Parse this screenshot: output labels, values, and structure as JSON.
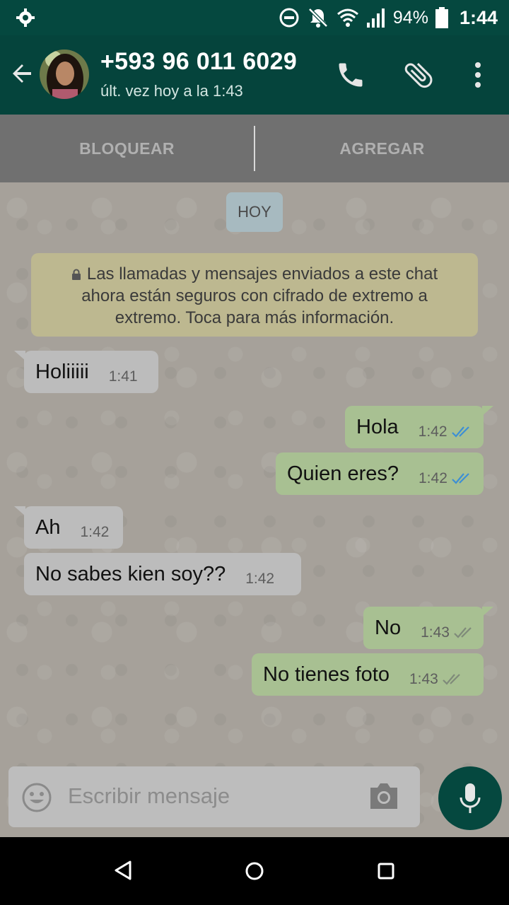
{
  "status_bar": {
    "battery_percent": "94%",
    "time": "1:44",
    "icons": [
      "settings-icon",
      "do-not-disturb-icon",
      "notifications-off-icon",
      "wifi-icon",
      "signal-icon",
      "battery-icon"
    ]
  },
  "header": {
    "contact_name": "+593 96 011 6029",
    "last_seen": "últ. vez hoy a la 1:43",
    "icons": [
      "back-arrow-icon",
      "avatar",
      "call-icon",
      "attach-icon",
      "more-vert-icon"
    ]
  },
  "actions": {
    "block_label": "BLOQUEAR",
    "add_label": "AGREGAR"
  },
  "chat": {
    "date_chip": "HOY",
    "encryption_notice": "Las llamadas y mensajes enviados a este chat ahora están seguros con cifrado de extremo a extremo. Toca para más información.",
    "messages": [
      {
        "direction": "in",
        "text": "Holiiiii",
        "time": "1:41"
      },
      {
        "direction": "out",
        "text": "Hola",
        "time": "1:42",
        "status": "read"
      },
      {
        "direction": "out",
        "text": "Quien eres?",
        "time": "1:42",
        "status": "read"
      },
      {
        "direction": "in",
        "text": "Ah",
        "time": "1:42"
      },
      {
        "direction": "in",
        "text": "No sabes kien soy??",
        "time": "1:42"
      },
      {
        "direction": "out",
        "text": "No",
        "time": "1:43",
        "status": "delivered"
      },
      {
        "direction": "out",
        "text": "No tienes foto",
        "time": "1:43",
        "status": "delivered"
      }
    ]
  },
  "composer": {
    "placeholder": "Escribir mensaje",
    "icons": [
      "emoji-icon",
      "camera-icon",
      "mic-icon"
    ]
  },
  "colors": {
    "header_bg": "#075e54",
    "status_bg": "#05483f",
    "incoming_bubble": "#bcbcbc",
    "outgoing_bubble": "#a8c092",
    "read_tick": "#3d8fd4",
    "delivered_tick": "#7f8a7a"
  }
}
